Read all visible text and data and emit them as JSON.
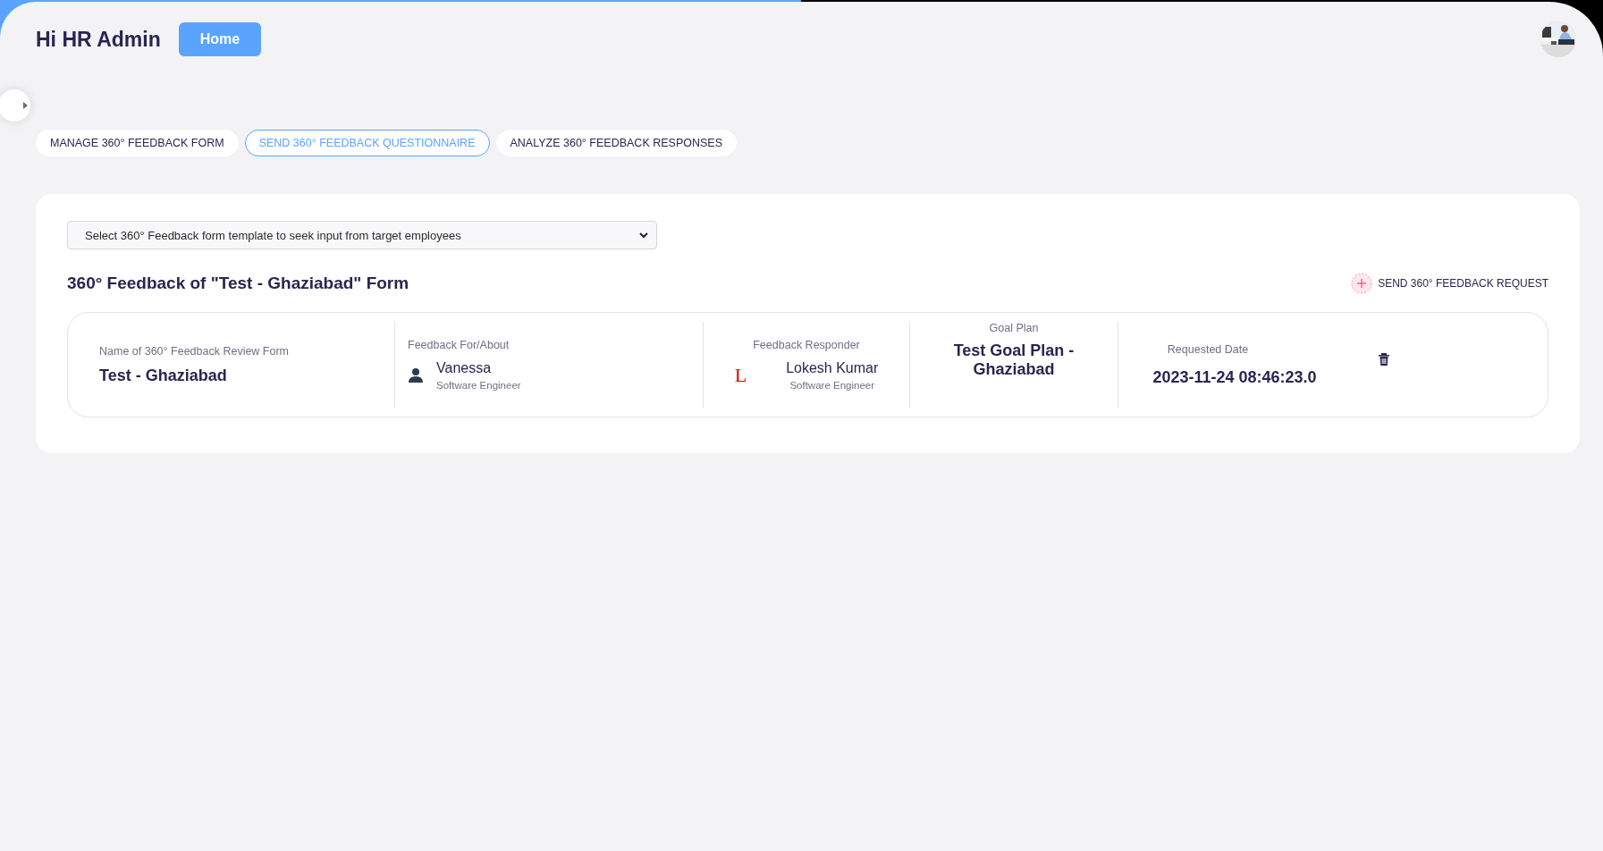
{
  "greeting": "Hi HR Admin",
  "home_button": "Home",
  "tabs": [
    {
      "label": "MANAGE 360° FEEDBACK FORM",
      "selected": false
    },
    {
      "label": "SEND 360° FEEDBACK QUESTIONNAIRE",
      "selected": true
    },
    {
      "label": "ANALYZE 360° FEEDBACK RESPONSES",
      "selected": false
    }
  ],
  "template_select": {
    "value": "Select 360° Feedback form template to seek input from target employees"
  },
  "section_title": "360° Feedback of \"Test - Ghaziabad\" Form",
  "send_request_button": "SEND 360° FEEDBACK REQUEST",
  "requests": [
    {
      "form_label": "Name of 360° Feedback Review Form",
      "form_name": "Test - Ghaziabad",
      "about_label": "Feedback For/About",
      "about_name": "Vanessa",
      "about_role": "Software Engineer",
      "responder_label": "Feedback Responder",
      "responder_image_alt": "L",
      "responder_name": "Lokesh Kumar",
      "responder_role": "Software Engineer",
      "goal_plan_label": "Goal Plan",
      "goal_plan": "Test Goal Plan - Ghaziabad",
      "date_label": "Requested Date",
      "date": "2023-11-24 08:46:23.0"
    }
  ]
}
